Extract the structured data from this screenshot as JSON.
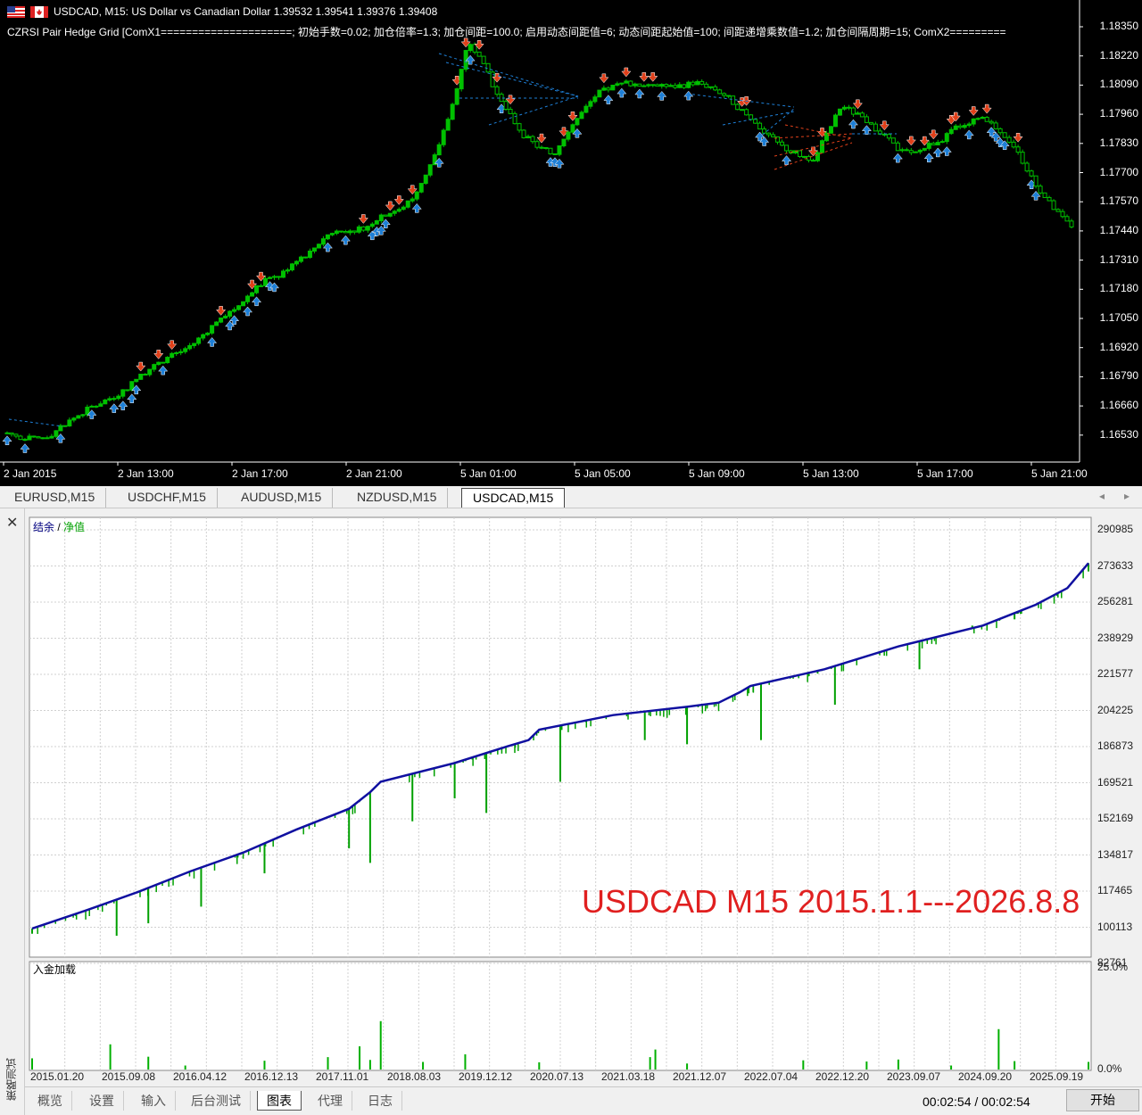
{
  "chart": {
    "symbol_header": "USDCAD, M15:  US Dollar vs Canadian Dollar  1.39532 1.39541 1.39376 1.39408",
    "indicator_line": "CZRSI Pair Hedge Grid [ComX1=====================; 初始手数=0.02; 加仓倍率=1.3; 加仓间距=100.0; 启用动态间距值=6; 动态间距起始值=100; 间距递增乘数值=1.2; 加仓间隔周期=15; ComX2=========",
    "price_labels": [
      "1.18350",
      "1.18220",
      "1.18090",
      "1.17960",
      "1.17830",
      "1.17700",
      "1.17570",
      "1.17440",
      "1.17310",
      "1.17180",
      "1.17050",
      "1.16920",
      "1.16790",
      "1.16660",
      "1.16530"
    ],
    "time_labels": [
      "2 Jan 2015",
      "2 Jan 13:00",
      "2 Jan 17:00",
      "2 Jan 21:00",
      "5 Jan 01:00",
      "5 Jan 05:00",
      "5 Jan 09:00",
      "5 Jan 13:00",
      "5 Jan 17:00",
      "5 Jan 21:00"
    ],
    "colors": {
      "background": "#000000",
      "bull": "#00c000",
      "bear_fill": "#000000",
      "buy_arrow": "#1e7fd6",
      "sell_arrow": "#e0401a"
    },
    "price_path": [
      1.1654,
      1.1652,
      1.1651,
      1.1653,
      1.1658,
      1.1662,
      1.1666,
      1.1669,
      1.1672,
      1.1678,
      1.1683,
      1.1687,
      1.169,
      1.1694,
      1.17,
      1.1706,
      1.171,
      1.1717,
      1.1722,
      1.1724,
      1.1731,
      1.1734,
      1.1741,
      1.1745,
      1.1744,
      1.1746,
      1.1751,
      1.1753,
      1.1757,
      1.1768,
      1.1781,
      1.1801,
      1.1828,
      1.1822,
      1.1805,
      1.1795,
      1.1786,
      1.1781,
      1.1778,
      1.1789,
      1.1797,
      1.1805,
      1.1808,
      1.181,
      1.1809,
      1.181,
      1.1808,
      1.1809,
      1.181,
      1.1808,
      1.1804,
      1.1798,
      1.1792,
      1.1786,
      1.1781,
      1.1778,
      1.1776,
      1.1787,
      1.18,
      1.1796,
      1.1792,
      1.1786,
      1.178,
      1.1778,
      1.1782,
      1.1785,
      1.179,
      1.1793,
      1.1794,
      1.1789,
      1.1782,
      1.177,
      1.176,
      1.1752,
      1.1746
    ]
  },
  "chart_tabs": [
    "EURUSD,M15",
    "USDCHF,M15",
    "AUDUSD,M15",
    "NZDUSD,M15",
    "USDCAD,M15"
  ],
  "active_chart_tab": "USDCAD,M15",
  "tester": {
    "legend_balance": "结余",
    "legend_sep": " / ",
    "legend_equity": "净值",
    "overlay_text": "USDCAD M15 2015.1.1---2026.8.8",
    "y_labels": [
      "290985",
      "273633",
      "256281",
      "238929",
      "221577",
      "204225",
      "186873",
      "169521",
      "152169",
      "134817",
      "117465",
      "100113",
      "82761"
    ],
    "load_label": "入金加载",
    "load_pct_top": "25.0%",
    "load_pct_bottom": "0.0%",
    "x_labels": [
      "2015.01.20",
      "2015.09.08",
      "2016.04.12",
      "2016.12.13",
      "2017.11.01",
      "2018.08.03",
      "2019.12.12",
      "2020.07.13",
      "2021.03.18",
      "2021.12.07",
      "2022.07.04",
      "2022.12.20",
      "2023.09.07",
      "2024.09.20",
      "2025.09.19"
    ],
    "side_label": "策略测试",
    "colors": {
      "balance": "#1010a0",
      "equity": "#00a000",
      "load": "#00b000",
      "grid": "#d0d0d0"
    },
    "balance_points": [
      [
        0,
        99500
      ],
      [
        0.05,
        108000
      ],
      [
        0.1,
        117000
      ],
      [
        0.15,
        127000
      ],
      [
        0.2,
        136000
      ],
      [
        0.25,
        147000
      ],
      [
        0.3,
        157000
      ],
      [
        0.32,
        165000
      ],
      [
        0.33,
        170000
      ],
      [
        0.4,
        179000
      ],
      [
        0.45,
        187000
      ],
      [
        0.47,
        190000
      ],
      [
        0.48,
        195000
      ],
      [
        0.55,
        202000
      ],
      [
        0.62,
        206000
      ],
      [
        0.65,
        208000
      ],
      [
        0.67,
        213000
      ],
      [
        0.68,
        216000
      ],
      [
        0.75,
        224000
      ],
      [
        0.82,
        235000
      ],
      [
        0.9,
        245000
      ],
      [
        0.95,
        255000
      ],
      [
        0.98,
        263000
      ],
      [
        1.0,
        275000
      ]
    ],
    "drawdowns": [
      [
        0.0,
        97000
      ],
      [
        0.08,
        96000
      ],
      [
        0.11,
        102000
      ],
      [
        0.16,
        110000
      ],
      [
        0.22,
        126000
      ],
      [
        0.3,
        138000
      ],
      [
        0.32,
        131000
      ],
      [
        0.36,
        151000
      ],
      [
        0.4,
        162000
      ],
      [
        0.43,
        155000
      ],
      [
        0.5,
        170000
      ],
      [
        0.58,
        190000
      ],
      [
        0.62,
        188000
      ],
      [
        0.69,
        190000
      ],
      [
        0.76,
        207000
      ],
      [
        0.84,
        224000
      ],
      [
        0.89,
        245000
      ],
      [
        0.93,
        248000
      ],
      [
        1.0,
        271000
      ]
    ],
    "load_bars": [
      [
        0.0,
        2.8
      ],
      [
        0.074,
        6.3
      ],
      [
        0.11,
        3.2
      ],
      [
        0.145,
        1.0
      ],
      [
        0.22,
        2.2
      ],
      [
        0.28,
        3.1
      ],
      [
        0.31,
        5.8
      ],
      [
        0.32,
        2.4
      ],
      [
        0.33,
        12.1
      ],
      [
        0.37,
        1.9
      ],
      [
        0.41,
        3.8
      ],
      [
        0.48,
        1.8
      ],
      [
        0.585,
        3.1
      ],
      [
        0.59,
        5.0
      ],
      [
        0.62,
        1.5
      ],
      [
        0.73,
        2.3
      ],
      [
        0.79,
        2.0
      ],
      [
        0.82,
        2.5
      ],
      [
        0.87,
        1.0
      ],
      [
        0.915,
        10.1
      ],
      [
        0.93,
        2.1
      ],
      [
        1.0,
        1.9
      ]
    ]
  },
  "bottom_tabs": [
    "概览",
    "设置",
    "输入",
    "后台测试",
    "图表",
    "代理",
    "日志"
  ],
  "active_bottom_tab": "图表",
  "timer": "00:02:54 / 00:02:54",
  "start_button": "开始"
}
